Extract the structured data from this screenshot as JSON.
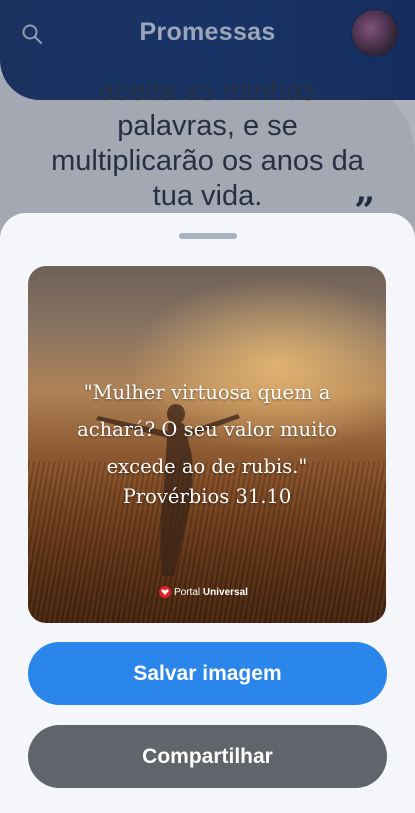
{
  "app": {
    "title": "Promessas",
    "verse_tail": "aceita as minhas palavras, e se multiplicarão os anos da tua vida.",
    "closing_quote": "”"
  },
  "image_card": {
    "quote_line1": "\"Mulher virtuosa quem a",
    "quote_line2": "achará? O seu valor muito",
    "quote_line3": "excede ao de rubis.\"",
    "reference": "Provérbios 31.10",
    "logo_prefix": "Portal",
    "logo_bold": "Universal"
  },
  "actions": {
    "save_label": "Salvar imagem",
    "share_label": "Compartilhar"
  },
  "colors": {
    "header": "#133678",
    "save_button": "#2a86ea",
    "share_button": "#5f656b",
    "sheet": "#f4f6fa"
  },
  "icons": [
    "search-icon",
    "avatar",
    "portal-universal-logo"
  ]
}
